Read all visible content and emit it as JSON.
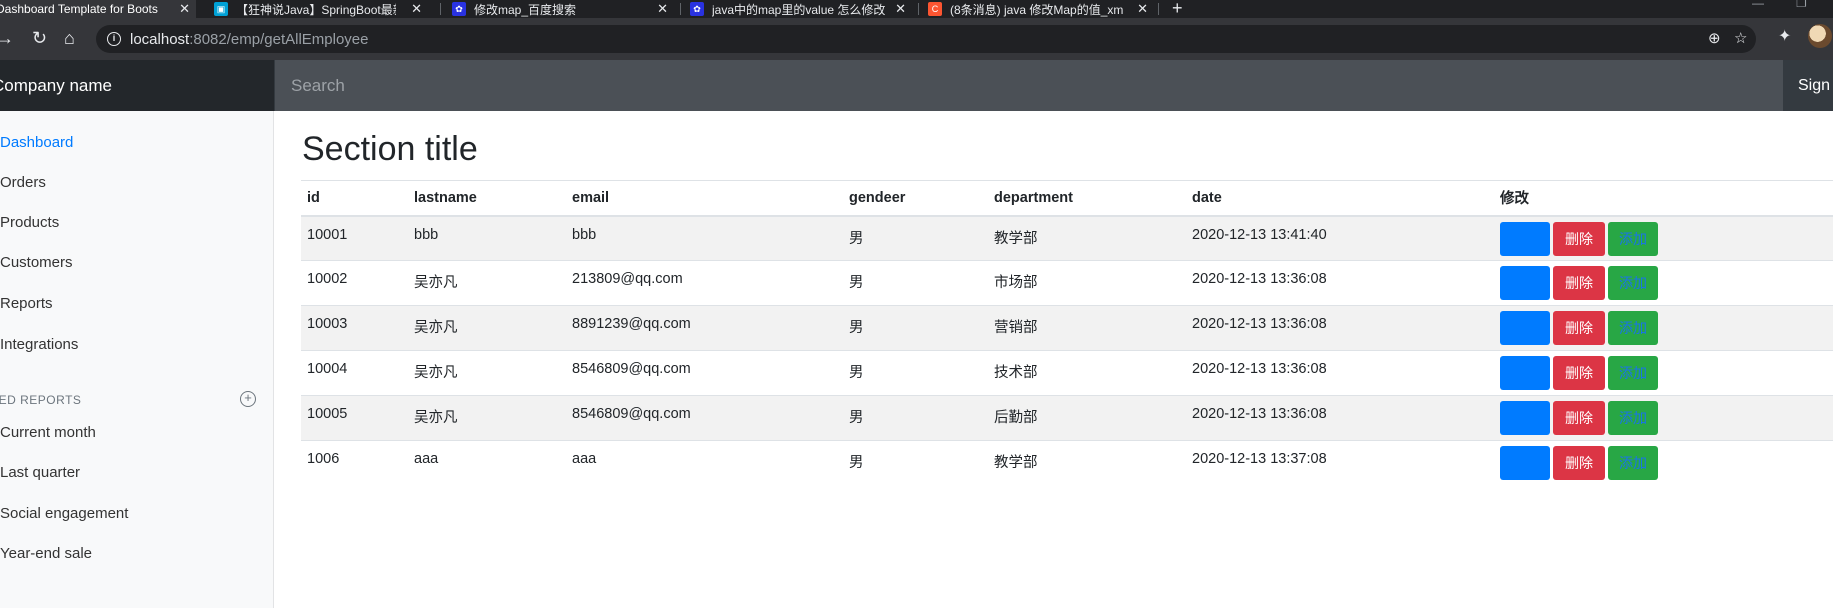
{
  "browser": {
    "tabs": [
      {
        "title": "Dashboard Template for Boots",
        "favicon_color": "#6f42c1",
        "active": true
      },
      {
        "title": "【狂神说Java】SpringBoot最新",
        "favicon_color": "#00a1d6",
        "active": false
      },
      {
        "title": "修改map_百度搜索",
        "favicon_color": "#2932e1",
        "active": false
      },
      {
        "title": "java中的map里的value 怎么修改",
        "favicon_color": "#2932e1",
        "active": false
      },
      {
        "title": "(8条消息) java 修改Map的值_xm",
        "favicon_color": "#fc5531",
        "active": false
      }
    ],
    "url_host": "localhost",
    "url_rest": ":8082/emp/getAllEmployee"
  },
  "navbar": {
    "brand": "Company name",
    "search_placeholder": "Search",
    "signout": "Sign out"
  },
  "sidebar": {
    "items": [
      {
        "label": "Dashboard",
        "active": true
      },
      {
        "label": "Orders"
      },
      {
        "label": "Products"
      },
      {
        "label": "Customers"
      },
      {
        "label": "Reports"
      },
      {
        "label": "Integrations"
      }
    ],
    "heading": "SAVED REPORTS",
    "reports": [
      {
        "label": "Current month"
      },
      {
        "label": "Last quarter"
      },
      {
        "label": "Social engagement"
      },
      {
        "label": "Year-end sale"
      }
    ]
  },
  "main": {
    "section_title": "Section title",
    "columns": [
      "id",
      "lastname",
      "email",
      "gendeer",
      "department",
      "date",
      "修改"
    ],
    "rows": [
      {
        "id": "10001",
        "lastname": "bbb",
        "email": "bbb",
        "gender": "男",
        "department": "教学部",
        "date": "2020-12-13 13:41:40"
      },
      {
        "id": "10002",
        "lastname": "吴亦凡",
        "email": "213809@qq.com",
        "gender": "男",
        "department": "市场部",
        "date": "2020-12-13 13:36:08"
      },
      {
        "id": "10003",
        "lastname": "吴亦凡",
        "email": "8891239@qq.com",
        "gender": "男",
        "department": "营销部",
        "date": "2020-12-13 13:36:08"
      },
      {
        "id": "10004",
        "lastname": "吴亦凡",
        "email": "8546809@qq.com",
        "gender": "男",
        "department": "技术部",
        "date": "2020-12-13 13:36:08"
      },
      {
        "id": "10005",
        "lastname": "吴亦凡",
        "email": "8546809@qq.com",
        "gender": "男",
        "department": "后勤部",
        "date": "2020-12-13 13:36:08"
      },
      {
        "id": "1006",
        "lastname": "aaa",
        "email": "aaa",
        "gender": "男",
        "department": "教学部",
        "date": "2020-12-13 13:37:08"
      }
    ],
    "actions": {
      "edit_label": "",
      "delete_label": "删除",
      "add_label": "添加"
    }
  }
}
